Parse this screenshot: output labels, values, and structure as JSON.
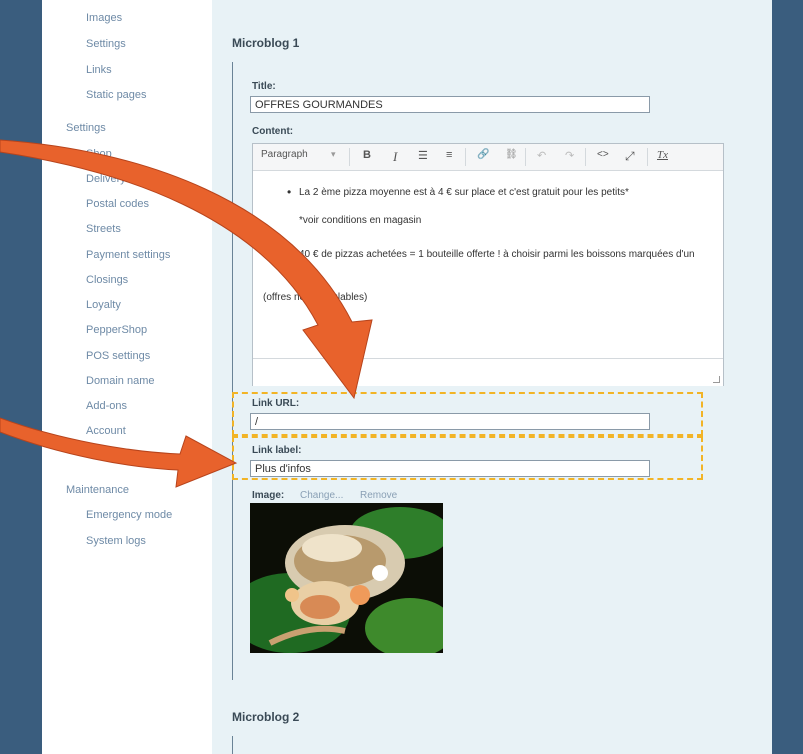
{
  "sidebar": {
    "items": [
      {
        "label": "Images",
        "level": "sub"
      },
      {
        "label": "Settings",
        "level": "sub"
      },
      {
        "label": "Links",
        "level": "sub"
      },
      {
        "label": "Static pages",
        "level": "sub"
      },
      {
        "label": "Settings",
        "level": "head"
      },
      {
        "label": "Shop",
        "level": "sub"
      },
      {
        "label": "Delivery settings",
        "level": "sub"
      },
      {
        "label": "Postal codes",
        "level": "sub"
      },
      {
        "label": "Streets",
        "level": "sub"
      },
      {
        "label": "Payment settings",
        "level": "sub"
      },
      {
        "label": "Closings",
        "level": "sub"
      },
      {
        "label": "Loyalty",
        "level": "sub"
      },
      {
        "label": "PepperShop",
        "level": "sub"
      },
      {
        "label": "POS settings",
        "level": "sub"
      },
      {
        "label": "Domain name",
        "level": "sub"
      },
      {
        "label": "Add-ons",
        "level": "sub"
      },
      {
        "label": "Account",
        "level": "sub"
      },
      {
        "label": "Maintenance",
        "level": "head"
      },
      {
        "label": "Emergency mode",
        "level": "sub"
      },
      {
        "label": "System logs",
        "level": "sub"
      }
    ]
  },
  "microblog1": {
    "title": "Microblog 1",
    "title_label": "Title:",
    "title_value": "OFFRES GOURMANDES",
    "content_label": "Content:",
    "toolbar": {
      "format": "Paragraph",
      "format_arrow": "▾",
      "bold": "B",
      "italic": "I",
      "ordered_list": "☰",
      "bullet_list": "≡",
      "link": "🔗",
      "unlink": "⛓",
      "undo": "↶",
      "redo": "↷",
      "code": "<>",
      "fullscreen": "⤢",
      "clear_format": "Tx"
    },
    "content": {
      "bullet1": "La 2 ème pizza moyenne est à 4 € sur place et c'est gratuit pour les petits*",
      "bullet1_note": "*voir conditions en magasin",
      "bullet2": "40 € de pizzas achetées  = 1 bouteille offerte ! à choisir parmi les boissons marquées d'un *",
      "footer": "(offres non cumulables)"
    },
    "link_url_label": "Link URL:",
    "link_url_value": "/",
    "link_label_label": "Link label:",
    "link_label_value": "Plus d'infos",
    "image_label": "Image:",
    "image_change": "Change...",
    "image_remove": "Remove"
  },
  "microblog2": {
    "title": "Microblog 2"
  },
  "colors": {
    "arrow": "#e8622c",
    "highlight": "#f2b426",
    "frame": "#3a5d7e"
  }
}
